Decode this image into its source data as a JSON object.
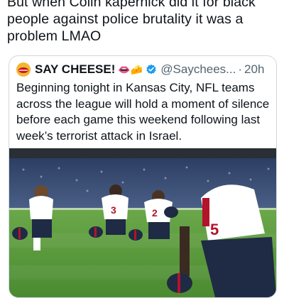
{
  "post": {
    "text": "But when Colin kapernick did it for black people against police brutality it was a problem LMAO"
  },
  "quote": {
    "author_name": "SAY CHEESE!",
    "emojis": "👄🧀",
    "handle": "@Saychees...",
    "separator": "·",
    "time": "20h",
    "text": "Beginning tonight in Kansas City, NFL teams across the league will hold a moment of silence before each game this weekend following last week’s terrorist attack in Israel."
  },
  "photo": {
    "jersey_numbers": [
      "3",
      "2",
      "5"
    ],
    "colors": {
      "grass": "#5b9a3c",
      "jersey": "#ffffff",
      "pants": "#1f2a44",
      "helmet_stripe": "#b3132b",
      "verified_blue": "#1d9bf0"
    }
  }
}
